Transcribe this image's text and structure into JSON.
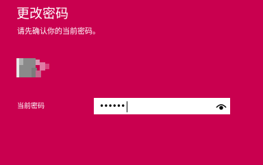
{
  "dialog": {
    "title": "更改密码",
    "subtitle": "请先确认你的当前密码。"
  },
  "form": {
    "current_password_label": "当前密码",
    "current_password_value": "••••••"
  },
  "icons": {
    "reveal": "eye-icon",
    "user": "avatar-pixelated"
  },
  "colors": {
    "background": "#c9004f",
    "text": "#ffffff",
    "field_background": "#ffffff"
  }
}
